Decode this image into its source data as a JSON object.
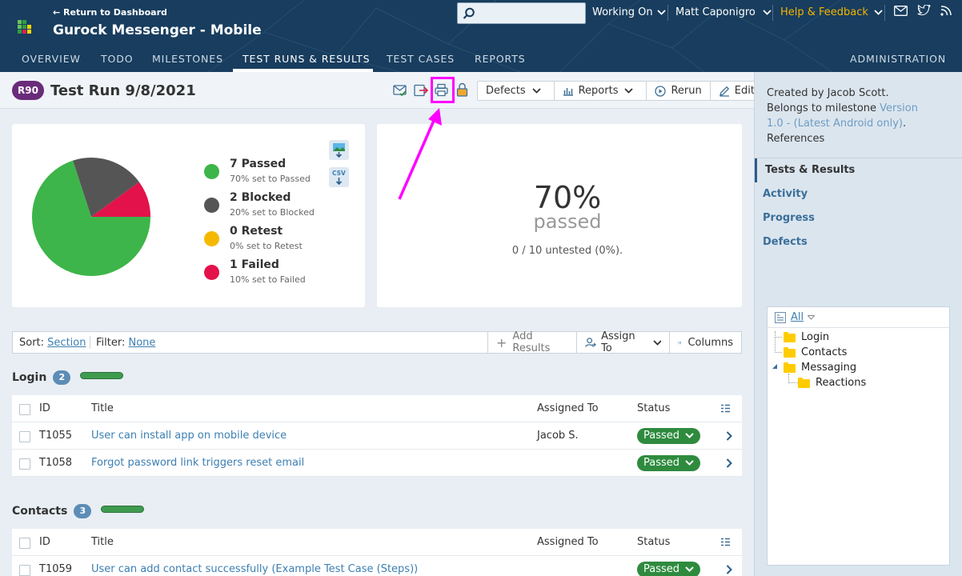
{
  "header": {
    "return_link": "Return to Dashboard",
    "project_title": "Gurock Messenger - Mobile",
    "search_placeholder": "",
    "working_on": "Working On",
    "user": "Matt Caponigro",
    "help": "Help & Feedback",
    "nav_tabs": [
      "OVERVIEW",
      "TODO",
      "MILESTONES",
      "TEST RUNS & RESULTS",
      "TEST CASES",
      "REPORTS"
    ],
    "active_tab": "TEST RUNS & RESULTS",
    "admin": "ADMINISTRATION"
  },
  "run": {
    "badge": "R90",
    "title": "Test Run 9/8/2021",
    "buttons": {
      "defects": "Defects",
      "reports": "Reports",
      "rerun": "Rerun",
      "edit": "Edit"
    }
  },
  "summary": {
    "legend": [
      {
        "title": "7 Passed",
        "sub": "70% set to Passed",
        "color": "#3db54a"
      },
      {
        "title": "2 Blocked",
        "sub": "20% set to Blocked",
        "color": "#555555"
      },
      {
        "title": "0 Retest",
        "sub": "0% set to Retest",
        "color": "#f5b800"
      },
      {
        "title": "1 Failed",
        "sub": "10% set to Failed",
        "color": "#e3124b"
      }
    ],
    "csv_label": "CSV",
    "percent": "70%",
    "percent_label": "passed",
    "untested": "0 / 10 untested (0%)."
  },
  "chart_data": {
    "type": "pie",
    "categories": [
      "Passed",
      "Blocked",
      "Retest",
      "Failed"
    ],
    "values": [
      7,
      2,
      0,
      1
    ],
    "colors": [
      "#3db54a",
      "#555555",
      "#f5b800",
      "#e3124b"
    ]
  },
  "filter": {
    "sort_label": "Sort:",
    "sort_value": "Section",
    "filter_label": "Filter:",
    "filter_value": "None",
    "add_results": "Add Results",
    "assign_to": "Assign To",
    "columns": "Columns"
  },
  "columns": {
    "id": "ID",
    "title": "Title",
    "assigned": "Assigned To",
    "status": "Status"
  },
  "sections": [
    {
      "name": "Login",
      "count": "2",
      "rows": [
        {
          "id": "T1055",
          "title": "User can install app on mobile device",
          "assigned": "Jacob S.",
          "status": "Passed"
        },
        {
          "id": "T1058",
          "title": "Forgot password link triggers reset email",
          "assigned": "",
          "status": "Passed"
        }
      ]
    },
    {
      "name": "Contacts",
      "count": "3",
      "rows": [
        {
          "id": "T1059",
          "title": "User can add contact successfully (Example Test Case (Steps))",
          "assigned": "",
          "status": "Passed"
        }
      ]
    }
  ],
  "side": {
    "info_prefix": "Created by Jacob Scott. Belongs to milestone ",
    "milestone_link": "Version 1.0 - (Latest Android only)",
    "info_suffix": ".",
    "references": "References",
    "nav": [
      "Tests & Results",
      "Activity",
      "Progress",
      "Defects"
    ],
    "tree_all": "All",
    "tree": [
      "Login",
      "Contacts",
      "Messaging",
      "Reactions"
    ]
  }
}
